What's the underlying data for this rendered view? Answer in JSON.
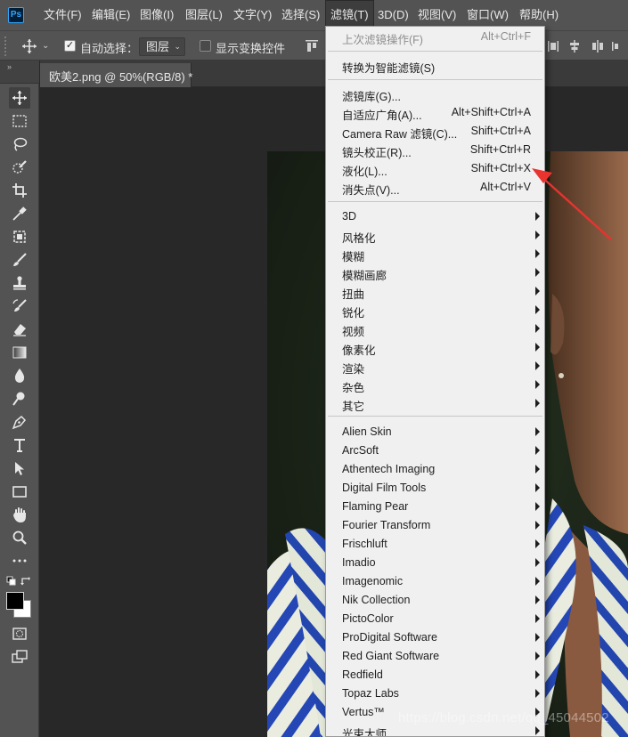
{
  "app": {
    "logo": "Ps",
    "menu_bar": [
      "文件(F)",
      "编辑(E)",
      "图像(I)",
      "图层(L)",
      "文字(Y)",
      "选择(S)",
      "滤镜(T)",
      "3D(D)",
      "视图(V)",
      "窗口(W)",
      "帮助(H)"
    ],
    "active_menu": "滤镜(T)"
  },
  "options_bar": {
    "auto_select_label": "自动选择：",
    "auto_select_checked": true,
    "layer_select_value": "图层",
    "show_transform_label": "显示变换控件",
    "show_transform_checked": false
  },
  "toolbar": {
    "collapse_glyph": "»",
    "tools": [
      "move-tool-icon",
      "marquee-tool-icon",
      "lasso-tool-icon",
      "quick-select-tool-icon",
      "crop-tool-icon",
      "eyedropper-tool-icon",
      "frame-tool-icon",
      "brush-tool-icon",
      "stamp-tool-icon",
      "history-brush-tool-icon",
      "eraser-tool-icon",
      "gradient-tool-icon",
      "blur-tool-icon",
      "dodge-tool-icon",
      "pen-tool-icon",
      "type-tool-icon",
      "path-select-tool-icon",
      "rectangle-tool-icon",
      "hand-tool-icon",
      "zoom-tool-icon",
      "more-tools-icon"
    ],
    "foreground_color": "#000000",
    "background_color": "#ffffff"
  },
  "document": {
    "tab_label": "欧美2.png @ 50%(RGB/8) *"
  },
  "filter_menu": {
    "top_items": [
      {
        "label": "上次滤镜操作(F)",
        "shortcut": "Alt+Ctrl+F",
        "disabled": true
      }
    ],
    "smart_items": [
      {
        "label": "转换为智能滤镜(S)"
      }
    ],
    "gallery_items": [
      {
        "label": "滤镜库(G)..."
      },
      {
        "label": "自适应广角(A)...",
        "shortcut": "Alt+Shift+Ctrl+A"
      },
      {
        "label": "Camera Raw 滤镜(C)...",
        "shortcut": "Shift+Ctrl+A"
      },
      {
        "label": "镜头校正(R)...",
        "shortcut": "Shift+Ctrl+R"
      },
      {
        "label": "液化(L)...",
        "shortcut": "Shift+Ctrl+X"
      },
      {
        "label": "消失点(V)...",
        "shortcut": "Alt+Ctrl+V"
      }
    ],
    "builtin_submenus": [
      "3D",
      "风格化",
      "模糊",
      "模糊画廊",
      "扭曲",
      "锐化",
      "视频",
      "像素化",
      "渲染",
      "杂色",
      "其它"
    ],
    "plugin_submenus": [
      "Alien Skin",
      "ArcSoft",
      "Athentech Imaging",
      "Digital Film Tools",
      "Flaming Pear",
      "Fourier Transform",
      "Frischluft",
      "Imadio",
      "Imagenomic",
      "Nik Collection",
      "PictoColor",
      "ProDigital Software",
      "Red Giant Software",
      "Redfield",
      "Topaz Labs",
      "Vertus™",
      "光束大师"
    ]
  },
  "annotation": {
    "arrow_color": "#e8332f"
  },
  "watermark": "https://blog.csdn.net/qq_45044502"
}
